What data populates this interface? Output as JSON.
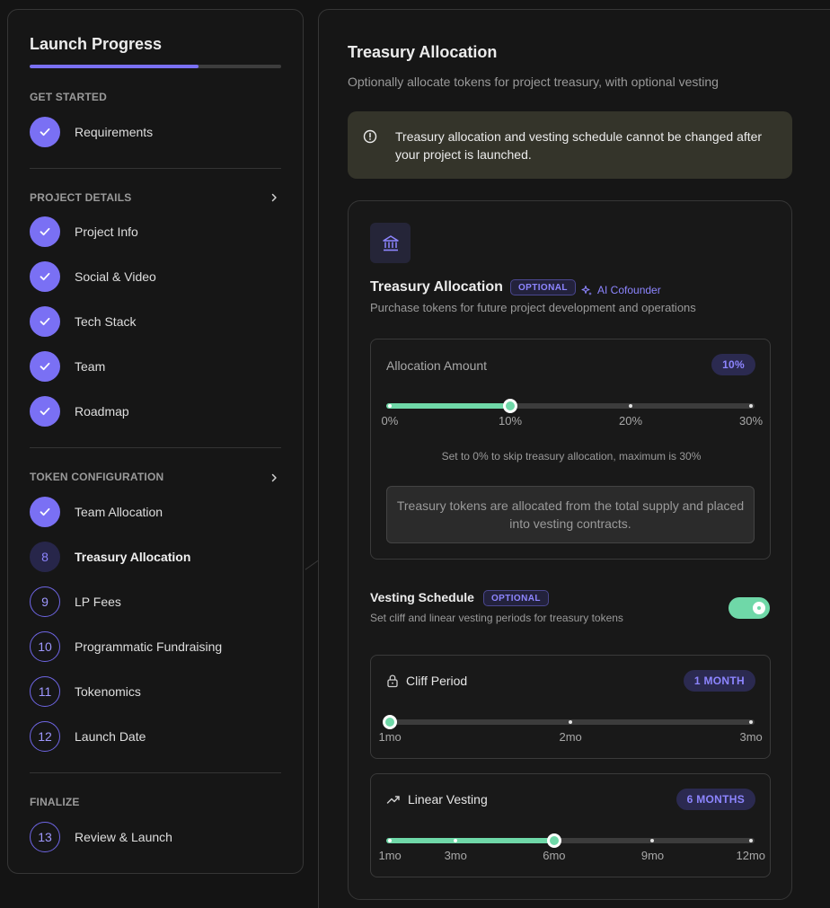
{
  "sidebar": {
    "title": "Launch Progress",
    "progress": 0.67,
    "sections": [
      {
        "heading": "GET STARTED"
      },
      {
        "heading": "PROJECT DETAILS"
      },
      {
        "heading": "TOKEN CONFIGURATION"
      },
      {
        "heading": "FINALIZE"
      }
    ],
    "steps": [
      {
        "label": "Requirements",
        "state": "done"
      },
      {
        "label": "Project Info",
        "state": "done"
      },
      {
        "label": "Social & Video",
        "state": "done"
      },
      {
        "label": "Tech Stack",
        "state": "done"
      },
      {
        "label": "Team",
        "state": "done"
      },
      {
        "label": "Roadmap",
        "state": "done"
      },
      {
        "label": "Team Allocation",
        "state": "done"
      },
      {
        "number": "8",
        "label": "Treasury Allocation",
        "state": "current"
      },
      {
        "number": "9",
        "label": "LP Fees",
        "state": "future"
      },
      {
        "number": "10",
        "label": "Programmatic Fundraising",
        "state": "future"
      },
      {
        "number": "11",
        "label": "Tokenomics",
        "state": "future"
      },
      {
        "number": "12",
        "label": "Launch Date",
        "state": "future"
      },
      {
        "number": "13",
        "label": "Review & Launch",
        "state": "future"
      }
    ]
  },
  "main": {
    "title": "Treasury Allocation",
    "subtitle": "Optionally allocate tokens for project treasury, with optional vesting",
    "warning": "Treasury allocation and vesting schedule cannot be changed after your project is launched.",
    "card": {
      "icon": "bank-icon",
      "title": "Treasury Allocation",
      "badge": "OPTIONAL",
      "cofounder_label": "AI Cofounder",
      "subtitle": "Purchase tokens for future project development and operations",
      "allocation": {
        "label": "Allocation Amount",
        "value_label": "10%",
        "value": 10,
        "min": 0,
        "max": 30,
        "ticks": [
          "0%",
          "10%",
          "20%",
          "30%"
        ],
        "hint": "Set to 0% to skip treasury allocation, maximum is 30%",
        "note": "Treasury tokens are allocated from the total supply and placed into vesting contracts."
      },
      "vesting": {
        "title": "Vesting Schedule",
        "badge": "OPTIONAL",
        "subtitle": "Set cliff and linear vesting periods for treasury tokens",
        "enabled": true
      },
      "cliff": {
        "label": "Cliff Period",
        "value_label": "1 MONTH",
        "value": 1,
        "min": 1,
        "max": 3,
        "ticks": [
          "1mo",
          "2mo",
          "3mo"
        ]
      },
      "linear": {
        "label": "Linear Vesting",
        "value_label": "6 MONTHS",
        "value": 6,
        "min": 1,
        "max": 12,
        "tick_values": [
          1,
          3,
          6,
          9,
          12
        ],
        "ticks": [
          "1mo",
          "3mo",
          "6mo",
          "9mo",
          "12mo"
        ]
      }
    }
  },
  "colors": {
    "accent": "#7a70f4",
    "success": "#6fd8a8",
    "warning_bg": "#34342a"
  }
}
